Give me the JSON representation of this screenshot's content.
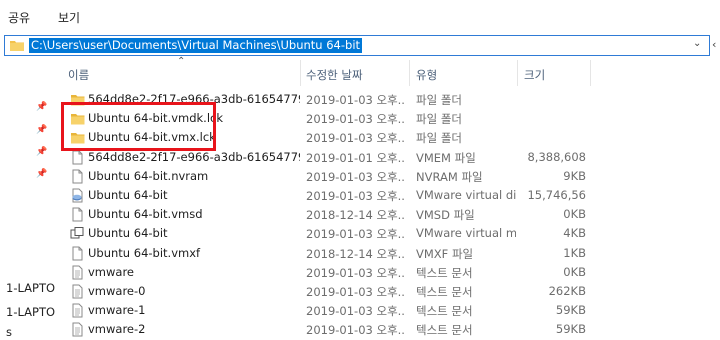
{
  "ribbon": {
    "tabs": [
      "공유",
      "보기"
    ]
  },
  "address": {
    "path": "C:\\Users\\user\\Documents\\Virtual Machines\\Ubuntu 64-bit",
    "chevron_icon": "chevron-down-icon",
    "extra": "‹"
  },
  "nav": {
    "items": [
      "1-LAPTO",
      "1-LAPTO",
      "s"
    ]
  },
  "columns": {
    "name": "이름",
    "date": "수정한 날짜",
    "type": "유형",
    "size": "크기"
  },
  "files": [
    {
      "name": "564dd8e2-2f17-e966-a3db-616547796...",
      "date": "2019-01-03 오후...",
      "type": "파일 폴더",
      "size": "",
      "icon": "folder-icon"
    },
    {
      "name": "Ubuntu 64-bit.vmdk.lck",
      "date": "2019-01-03 오후...",
      "type": "파일 폴더",
      "size": "",
      "icon": "folder-icon"
    },
    {
      "name": "Ubuntu 64-bit.vmx.lck",
      "date": "2019-01-03 오후...",
      "type": "파일 폴더",
      "size": "",
      "icon": "folder-icon"
    },
    {
      "name": "564dd8e2-2f17-e966-a3db-616547796...",
      "date": "2019-01-01 오후...",
      "type": "VMEM 파일",
      "size": "8,388,608",
      "icon": "file-icon"
    },
    {
      "name": "Ubuntu 64-bit.nvram",
      "date": "2019-01-03 오후...",
      "type": "NVRAM 파일",
      "size": "9KB",
      "icon": "file-icon"
    },
    {
      "name": "Ubuntu 64-bit",
      "date": "2019-01-03 오후...",
      "type": "VMware virtual di...",
      "size": "15,746,56",
      "icon": "vmdk-icon"
    },
    {
      "name": "Ubuntu 64-bit.vmsd",
      "date": "2018-12-14 오후...",
      "type": "VMSD 파일",
      "size": "0KB",
      "icon": "file-icon"
    },
    {
      "name": "Ubuntu 64-bit",
      "date": "2019-01-03 오후...",
      "type": "VMware virtual m...",
      "size": "4KB",
      "icon": "vmx-icon"
    },
    {
      "name": "Ubuntu 64-bit.vmxf",
      "date": "2018-12-14 오후...",
      "type": "VMXF 파일",
      "size": "1KB",
      "icon": "file-icon"
    },
    {
      "name": "vmware",
      "date": "2019-01-03 오후...",
      "type": "텍스트 문서",
      "size": "0KB",
      "icon": "text-file-icon"
    },
    {
      "name": "vmware-0",
      "date": "2019-01-03 오후...",
      "type": "텍스트 문서",
      "size": "262KB",
      "icon": "text-file-icon"
    },
    {
      "name": "vmware-1",
      "date": "2019-01-03 오후...",
      "type": "텍스트 문서",
      "size": "59KB",
      "icon": "text-file-icon"
    },
    {
      "name": "vmware-2",
      "date": "2019-01-03 오후...",
      "type": "텍스트 문서",
      "size": "59KB",
      "icon": "text-file-icon"
    }
  ],
  "colors": {
    "accent": "#0078d7",
    "folder": "#f3c24d",
    "highlight": "#e8141b"
  }
}
